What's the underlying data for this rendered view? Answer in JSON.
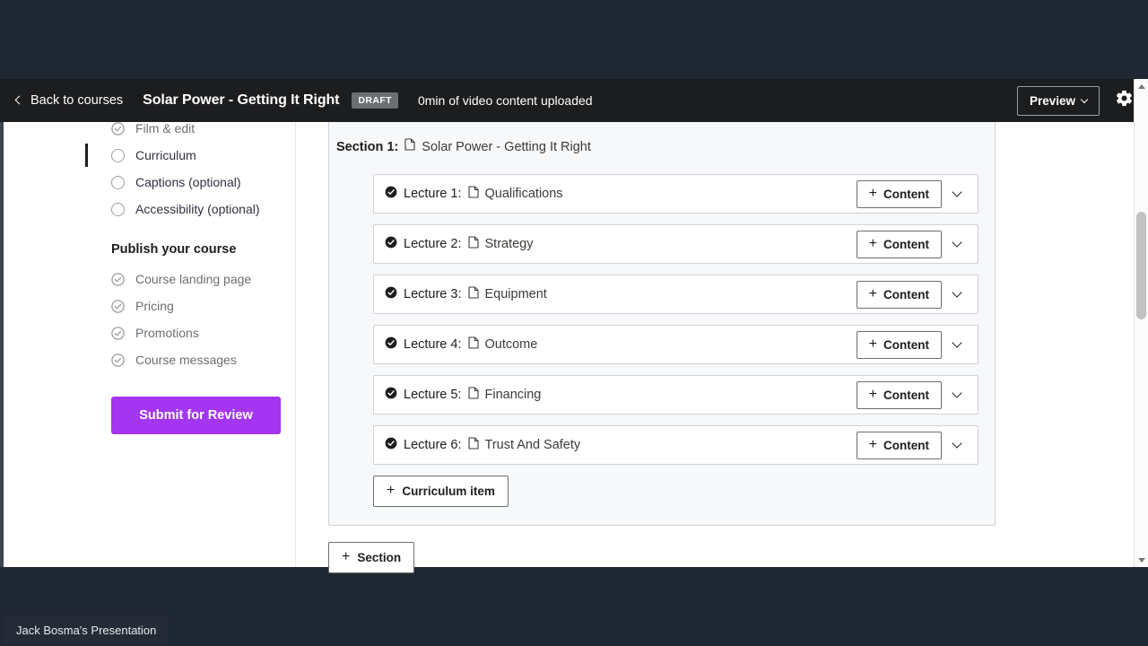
{
  "colors": {
    "page_bg": "#1f2733",
    "topbar_bg": "#1c1d1f",
    "accent_purple": "#a435f0",
    "badge_gray": "#6a6f73",
    "panel_bg": "#f7f8fa",
    "border_gray": "#d1d2d6"
  },
  "topbar": {
    "back_label": "Back to courses",
    "back_icon": "chevron-left-icon",
    "course_title": "Solar Power - Getting It Right",
    "status_badge": "DRAFT",
    "video_status": "0min of video content uploaded",
    "preview_label": "Preview",
    "preview_icon": "chevron-down-icon",
    "settings_icon": "gear-icon"
  },
  "sidebar": {
    "create_items": [
      {
        "label": "Film & edit",
        "state": "complete",
        "icon": "check-circle-icon",
        "active": false
      },
      {
        "label": "Curriculum",
        "state": "incomplete",
        "icon": "circle-icon",
        "active": true
      },
      {
        "label": "Captions (optional)",
        "state": "incomplete",
        "icon": "circle-icon",
        "active": false
      },
      {
        "label": "Accessibility (optional)",
        "state": "incomplete",
        "icon": "circle-icon",
        "active": false
      }
    ],
    "publish_heading": "Publish your course",
    "publish_items": [
      {
        "label": "Course landing page",
        "state": "complete",
        "icon": "check-circle-icon"
      },
      {
        "label": "Pricing",
        "state": "complete",
        "icon": "check-circle-icon"
      },
      {
        "label": "Promotions",
        "state": "complete",
        "icon": "check-circle-icon"
      },
      {
        "label": "Course messages",
        "state": "complete",
        "icon": "check-circle-icon"
      }
    ],
    "submit_label": "Submit for Review"
  },
  "curriculum": {
    "section": {
      "prefix": "Section 1:",
      "icon": "document-icon",
      "title": "Solar Power - Getting It Right"
    },
    "lectures": [
      {
        "prefix": "Lecture 1:",
        "title": "Qualifications",
        "status_icon": "check-filled-icon",
        "doc_icon": "document-icon",
        "add_label": "Content",
        "expand_icon": "chevron-down-icon"
      },
      {
        "prefix": "Lecture 2:",
        "title": "Strategy",
        "status_icon": "check-filled-icon",
        "doc_icon": "document-icon",
        "add_label": "Content",
        "expand_icon": "chevron-down-icon"
      },
      {
        "prefix": "Lecture 3:",
        "title": "Equipment",
        "status_icon": "check-filled-icon",
        "doc_icon": "document-icon",
        "add_label": "Content",
        "expand_icon": "chevron-down-icon"
      },
      {
        "prefix": "Lecture 4:",
        "title": "Outcome",
        "status_icon": "check-filled-icon",
        "doc_icon": "document-icon",
        "add_label": "Content",
        "expand_icon": "chevron-down-icon"
      },
      {
        "prefix": "Lecture 5:",
        "title": "Financing",
        "status_icon": "check-filled-icon",
        "doc_icon": "document-icon",
        "add_label": "Content",
        "expand_icon": "chevron-down-icon"
      },
      {
        "prefix": "Lecture 6:",
        "title": "Trust And Safety",
        "status_icon": "check-filled-icon",
        "doc_icon": "document-icon",
        "add_label": "Content",
        "expand_icon": "chevron-down-icon"
      }
    ],
    "add_curriculum_item_label": "Curriculum item",
    "add_section_label": "Section",
    "plus_glyph": "+"
  },
  "scrollbar": {
    "up_icon": "triangle-up-icon",
    "down_icon": "triangle-down-icon"
  },
  "overlay": {
    "presentation_label": "Jack Bosma's Presentation"
  }
}
